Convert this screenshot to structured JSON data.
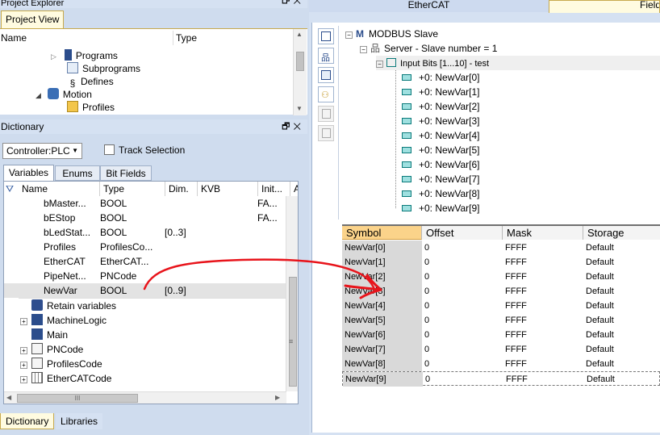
{
  "project_explorer": {
    "title": "Project Explorer",
    "tab": "Project View",
    "headers": {
      "name": "Name",
      "type": "Type"
    },
    "items": [
      {
        "label": "Programs"
      },
      {
        "label": "Subprograms"
      },
      {
        "label": "Defines"
      },
      {
        "label": "Motion"
      },
      {
        "label": "Profiles"
      }
    ]
  },
  "dictionary": {
    "title": "Dictionary",
    "controller": "Controller:PLC",
    "track_selection": "Track Selection",
    "tabs": [
      "Variables",
      "Enums",
      "Bit Fields"
    ],
    "columns": [
      "Name",
      "Type",
      "Dim.",
      "KVB",
      "Init...",
      "A"
    ],
    "rows": [
      {
        "name": "bMaster...",
        "type": "BOOL",
        "dim": "",
        "kvb": "",
        "init": "FA..."
      },
      {
        "name": "bEStop",
        "type": "BOOL",
        "dim": "",
        "kvb": "",
        "init": "FA..."
      },
      {
        "name": "bLedStat...",
        "type": "BOOL",
        "dim": "[0..3]",
        "kvb": "",
        "init": ""
      },
      {
        "name": "Profiles",
        "type": "ProfilesCo...",
        "dim": "",
        "kvb": "",
        "init": ""
      },
      {
        "name": "EtherCAT",
        "type": "EtherCAT...",
        "dim": "",
        "kvb": "",
        "init": ""
      },
      {
        "name": "PipeNet...",
        "type": "PNCode",
        "dim": "",
        "kvb": "",
        "init": ""
      },
      {
        "name": "NewVar",
        "type": "BOOL",
        "dim": "[0..9]",
        "kvb": "",
        "init": ""
      }
    ],
    "groups": [
      {
        "label": "Retain variables"
      },
      {
        "label": "MachineLogic"
      },
      {
        "label": "Main"
      },
      {
        "label": "PNCode"
      },
      {
        "label": "ProfilesCode"
      },
      {
        "label": "EtherCATCode"
      }
    ],
    "hscroll_grip": "III"
  },
  "bottom_tabs": [
    "Dictionary",
    "Libraries"
  ],
  "right_tabs": [
    "EtherCAT",
    "FieldB"
  ],
  "ethercat_tree": {
    "root": "MODBUS Slave",
    "root_icon_text": "M",
    "server": "Server - Slave number = 1",
    "input_bits": "Input Bits [1...10] - test",
    "vars": [
      "+0: NewVar[0]",
      "+0: NewVar[1]",
      "+0: NewVar[2]",
      "+0: NewVar[3]",
      "+0: NewVar[4]",
      "+0: NewVar[5]",
      "+0: NewVar[6]",
      "+0: NewVar[7]",
      "+0: NewVar[8]",
      "+0: NewVar[9]"
    ]
  },
  "grid": {
    "columns": [
      "Symbol",
      "Offset",
      "Mask",
      "Storage"
    ],
    "rows": [
      {
        "symbol": "NewVar[0]",
        "offset": "0",
        "mask": "FFFF",
        "storage": "Default"
      },
      {
        "symbol": "NewVar[1]",
        "offset": "0",
        "mask": "FFFF",
        "storage": "Default"
      },
      {
        "symbol": "NewVar[2]",
        "offset": "0",
        "mask": "FFFF",
        "storage": "Default"
      },
      {
        "symbol": "NewVar[3]",
        "offset": "0",
        "mask": "FFFF",
        "storage": "Default"
      },
      {
        "symbol": "NewVar[4]",
        "offset": "0",
        "mask": "FFFF",
        "storage": "Default"
      },
      {
        "symbol": "NewVar[5]",
        "offset": "0",
        "mask": "FFFF",
        "storage": "Default"
      },
      {
        "symbol": "NewVar[6]",
        "offset": "0",
        "mask": "FFFF",
        "storage": "Default"
      },
      {
        "symbol": "NewVar[7]",
        "offset": "0",
        "mask": "FFFF",
        "storage": "Default"
      },
      {
        "symbol": "NewVar[8]",
        "offset": "0",
        "mask": "FFFF",
        "storage": "Default"
      },
      {
        "symbol": "NewVar[9]",
        "offset": "0",
        "mask": "FFFF",
        "storage": "Default"
      }
    ]
  },
  "colors": {
    "accent_orange": "#fbd38a",
    "arrow_red": "#e8141b",
    "panel_blue": "#d5e1f2"
  }
}
